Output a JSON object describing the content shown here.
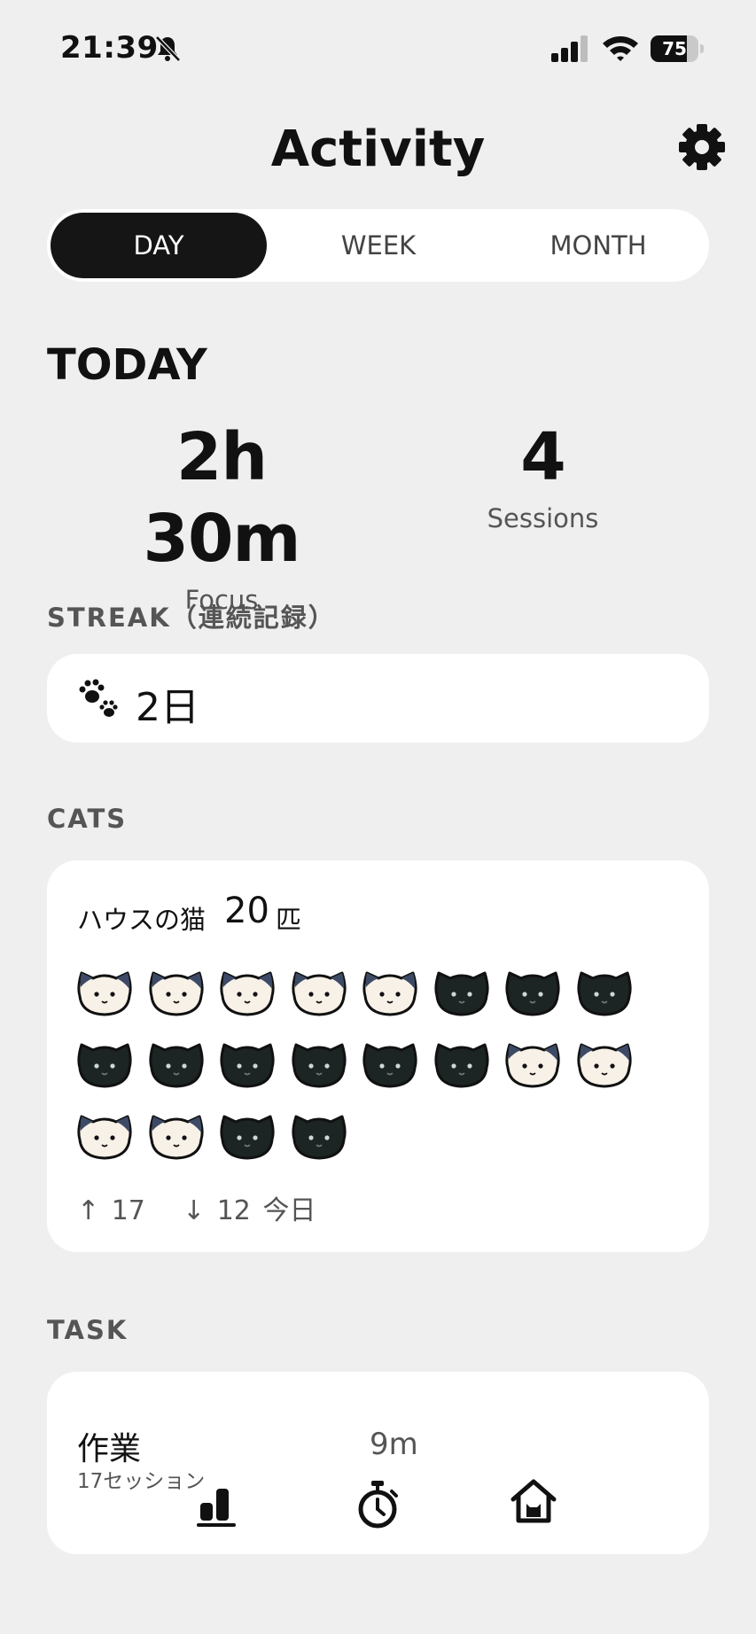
{
  "status_bar": {
    "time": "21:39",
    "battery_level": "75",
    "battery_fraction": 0.75
  },
  "header": {
    "title": "Activity",
    "settings_icon": "gear-icon"
  },
  "segments": {
    "day": "DAY",
    "week": "WEEK",
    "month": "MONTH",
    "selected": "DAY"
  },
  "today": {
    "heading": "TODAY",
    "focus_value": "2h 30m",
    "focus_label": "Focus",
    "sessions_value": "4",
    "sessions_label": "Sessions"
  },
  "streak": {
    "label": "STREAK（連続記録）",
    "icon": "paw-icon",
    "value": "2日"
  },
  "cats": {
    "label": "CATS",
    "house_label": "ハウスの猫",
    "house_count": "20",
    "house_unit": "匹",
    "cat_types": [
      "calico",
      "calico",
      "calico",
      "calico",
      "calico",
      "black",
      "black",
      "black",
      "black",
      "black",
      "black",
      "black",
      "black",
      "black",
      "calico",
      "calico",
      "calico",
      "calico",
      "black",
      "black"
    ],
    "up_arrow": "↑",
    "up_count": "17",
    "down_arrow": "↓",
    "down_count": "12",
    "changes_suffix": "今日"
  },
  "task": {
    "label": "TASK",
    "name": "作業",
    "sessions": "17セッション",
    "duration": "9m"
  },
  "tab_bar": {
    "items": [
      "stats-icon",
      "timer-icon",
      "home-icon"
    ]
  }
}
